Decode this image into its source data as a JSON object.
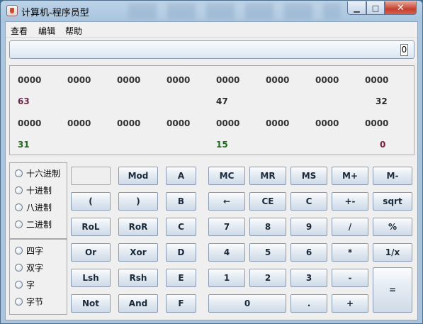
{
  "window": {
    "title": "计算机-程序员型",
    "min_label": "▁",
    "max_label": "□",
    "close_label": "✕"
  },
  "menu": [
    "查看",
    "编辑",
    "帮助"
  ],
  "display": {
    "value": "0"
  },
  "bits": {
    "row1": [
      "0000",
      "0000",
      "0000",
      "0000",
      "0000",
      "0000",
      "0000",
      "0000"
    ],
    "row1_labels": [
      "63",
      "47",
      "32"
    ],
    "row2": [
      "0000",
      "0000",
      "0000",
      "0000",
      "0000",
      "0000",
      "0000",
      "0000"
    ],
    "row2_labels": [
      "31",
      "15",
      "0"
    ],
    "label_colors": {
      "63": "#6b2a4a",
      "47": "#2a2a2a",
      "32": "#2a2a2a",
      "31": "#1f6a1f",
      "15": "#1f6a1f",
      "0": "#7a1f3a"
    }
  },
  "radix": [
    "十六进制",
    "十进制",
    "八进制",
    "二进制"
  ],
  "word": [
    "四字",
    "双字",
    "字",
    "字节"
  ],
  "keys": {
    "mod": "Mod",
    "a": "A",
    "lparen": "(",
    "rparen": ")",
    "b": "B",
    "rol": "RoL",
    "ror": "RoR",
    "c_hex": "C",
    "or": "Or",
    "xor": "Xor",
    "d": "D",
    "lsh": "Lsh",
    "rsh": "Rsh",
    "e": "E",
    "not": "Not",
    "and": "And",
    "f": "F",
    "mc": "MC",
    "mr": "MR",
    "ms": "MS",
    "mplus": "M+",
    "mminus": "M-",
    "back": "←",
    "ce": "CE",
    "clear": "C",
    "plusminus": "+-",
    "sqrt": "sqrt",
    "n7": "7",
    "n8": "8",
    "n9": "9",
    "div": "/",
    "pct": "%",
    "n4": "4",
    "n5": "5",
    "n6": "6",
    "mul": "*",
    "recip": "1/x",
    "n1": "1",
    "n2": "2",
    "n3": "3",
    "sub": "-",
    "eq": "=",
    "n0": "0",
    "dot": ".",
    "add": "+"
  }
}
